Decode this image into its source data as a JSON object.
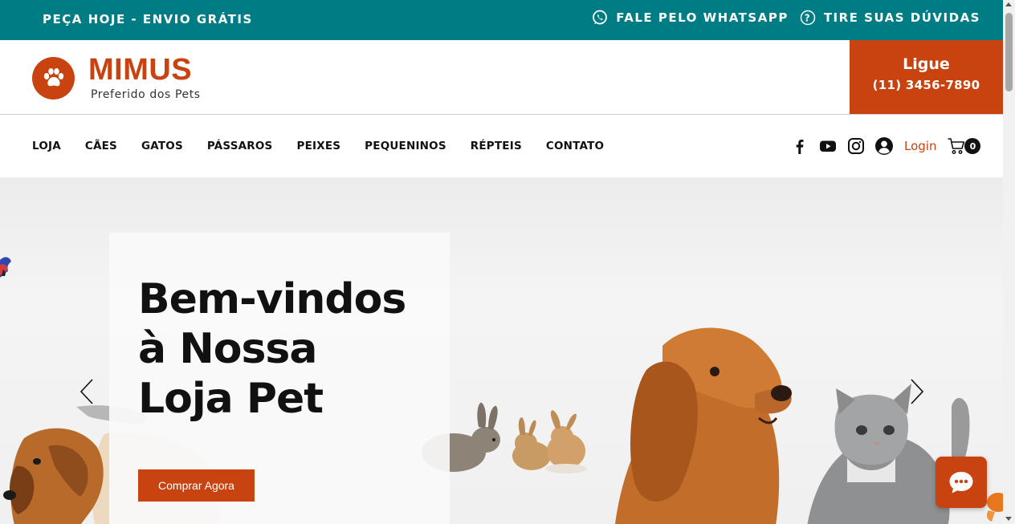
{
  "topbar": {
    "promo": "PEÇA HOJE - ENVIO GRÁTIS",
    "whatsapp_label": "FALE PELO WHATSAPP",
    "faq_label": "TIRE SUAS DÚVIDAS",
    "background_color": "#007d84"
  },
  "header": {
    "brand": "MIMUS",
    "tagline": "Preferido dos Pets",
    "call_title": "Ligue",
    "call_phone": "(11) 3456-7890",
    "accent_color": "#c8430f"
  },
  "nav": {
    "items": [
      {
        "label": "LOJA"
      },
      {
        "label": "CÃES"
      },
      {
        "label": "GATOS"
      },
      {
        "label": "PÁSSAROS"
      },
      {
        "label": "PEIXES"
      },
      {
        "label": "PEQUENINOS"
      },
      {
        "label": "RÉPTEIS"
      },
      {
        "label": "CONTATO"
      }
    ],
    "social_icons": [
      "facebook-icon",
      "youtube-icon",
      "instagram-icon"
    ],
    "login_label": "Login",
    "cart_count": "0"
  },
  "hero": {
    "title_lines": [
      "Bem-vindos",
      "à Nossa",
      "Loja Pet"
    ],
    "cta_label": "Comprar Agora"
  }
}
